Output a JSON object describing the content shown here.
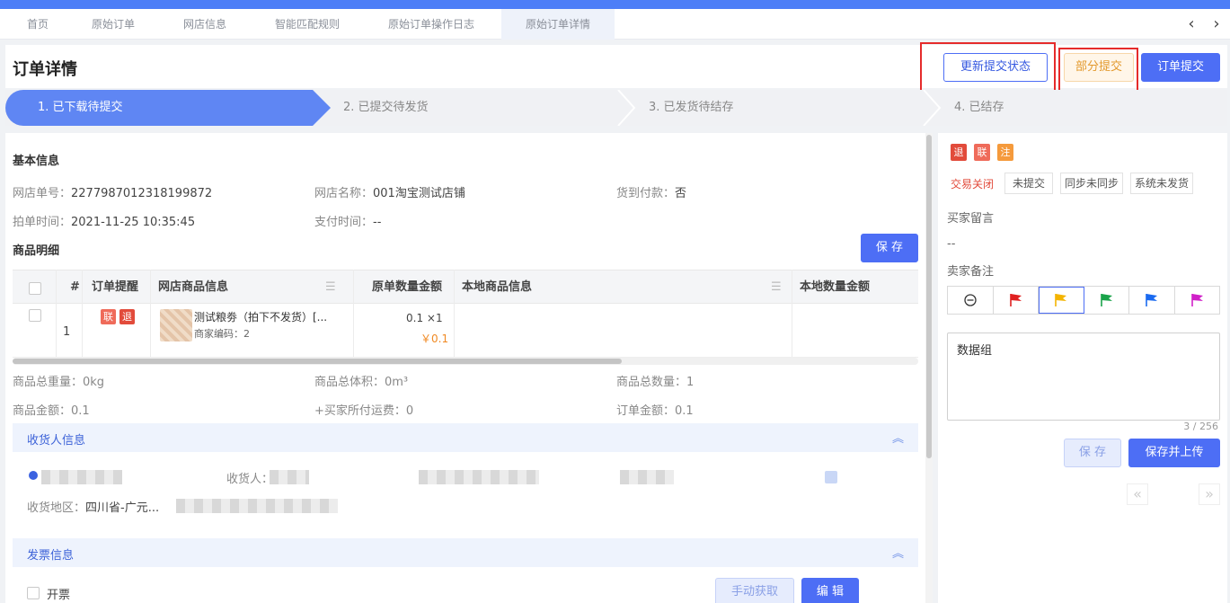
{
  "tabs": [
    {
      "label": "首页"
    },
    {
      "label": "原始订单"
    },
    {
      "label": "网店信息"
    },
    {
      "label": "智能匹配规则"
    },
    {
      "label": "原始订单操作日志"
    },
    {
      "label": "原始订单详情"
    }
  ],
  "header": {
    "title": "订单详情",
    "update_status_label": "更新提交状态",
    "partial_submit_label": "部分提交",
    "order_submit_label": "订单提交"
  },
  "steps": [
    {
      "label": "1. 已下载待提交"
    },
    {
      "label": "2. 已提交待发货"
    },
    {
      "label": "3. 已发货待结存"
    },
    {
      "label": "4. 已结存"
    }
  ],
  "basic_info": {
    "title": "基本信息",
    "shop_order_no_label": "网店单号：",
    "shop_order_no": "2277987012318199872",
    "shop_name_label": "网店名称：",
    "shop_name": "001淘宝测试店铺",
    "cod_label": "货到付款：",
    "cod": "否",
    "order_time_label": "拍单时间：",
    "order_time": "2021-11-25 10:35:45",
    "pay_time_label": "支付时间：",
    "pay_time": "--"
  },
  "goods": {
    "title": "商品明细",
    "save_label": "保 存",
    "columns": [
      "#",
      "订单提醒",
      "网店商品信息",
      "原单数量金额",
      "本地商品信息",
      "本地数量金额"
    ],
    "row": {
      "index": "1",
      "tag1": "联",
      "tag2": "退",
      "name": "测试粮劵（拍下不发货）[...",
      "code": "商家编码：2",
      "qty": "0.1 ×1",
      "price": "￥0.1"
    }
  },
  "summary": {
    "weight": "商品总重量：0kg",
    "volume": "商品总体积：0m³",
    "count": "商品总数量：1",
    "amount": "商品金额：0.1",
    "freight": "+买家所付运费：0",
    "order_amount": "订单金额：0.1"
  },
  "receiver": {
    "title": "收货人信息",
    "receiver_label": "收货人：",
    "area_label": "收货地区：",
    "area_visible": "四川省-广元..."
  },
  "invoice": {
    "title": "发票信息",
    "checkbox_label": "开票",
    "fetch_label": "手动获取",
    "edit_label": "编 辑"
  },
  "right": {
    "tags": [
      "退",
      "联",
      "注"
    ],
    "trade_closed": "交易关闭",
    "chips": [
      "未提交",
      "同步未同步",
      "系统未发货"
    ],
    "buyer_msg_label": "买家留言",
    "buyer_msg": "--",
    "seller_note_label": "卖家备注",
    "flag_colors": [
      "#e02020",
      "#f4b400",
      "#1aa34a",
      "#1a6af0",
      "#d020c8"
    ],
    "note_text": "数据组",
    "char_count": "3 / 256",
    "save_label": "保 存",
    "save_upload_label": "保存并上传"
  },
  "colors": {
    "accent": "#4d6ef5",
    "red_highlight": "#e52b2b"
  }
}
